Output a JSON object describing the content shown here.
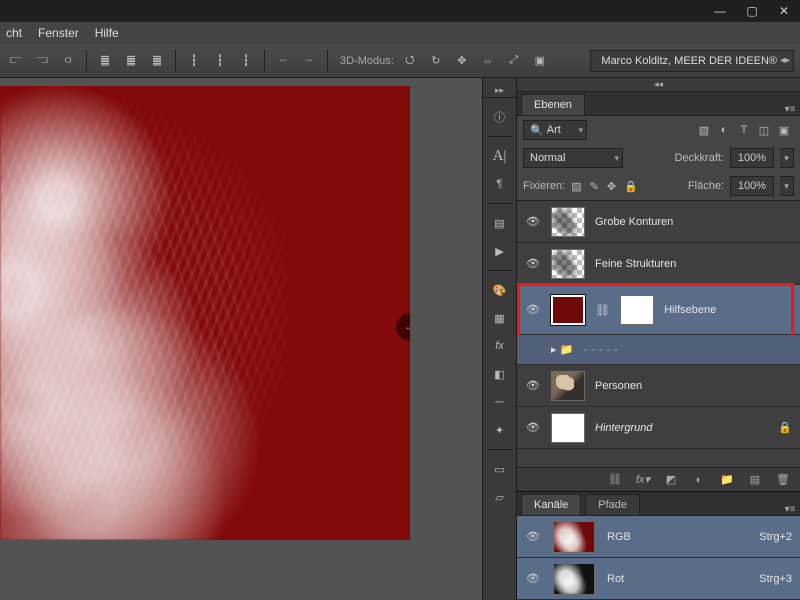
{
  "menu": {
    "item1": "cht",
    "item2": "Fenster",
    "item3": "Hilfe"
  },
  "toolbar": {
    "mode_label": "3D-Modus:"
  },
  "workspace_dropdown": "Marco Kolditz, MEER DER IDEEN®",
  "panels": {
    "layers": {
      "tab": "Ebenen",
      "filter_dropdown": "Art",
      "blend_mode": "Normal",
      "opacity_label": "Deckkraft:",
      "opacity_value": "100%",
      "fill_label": "Fläche:",
      "fill_value": "100%",
      "lock_label": "Fixieren:"
    },
    "layers_list": [
      {
        "name": "Grobe Konturen"
      },
      {
        "name": "Feine Strukturen"
      },
      {
        "name": "Hilfsebene"
      },
      {
        "name": "Personen"
      },
      {
        "name": "Hintergrund"
      }
    ],
    "channels": {
      "tab1": "Kanäle",
      "tab2": "Pfade",
      "rows": [
        {
          "name": "RGB",
          "shortcut": "Strg+2"
        },
        {
          "name": "Rot",
          "shortcut": "Strg+3"
        }
      ]
    }
  }
}
